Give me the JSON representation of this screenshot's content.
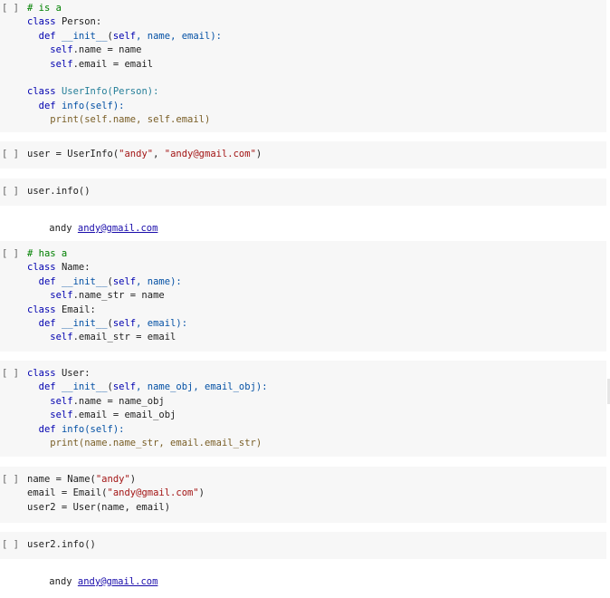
{
  "prompt_label": "[ ]",
  "cells": [
    {
      "lines": [
        [
          {
            "t": "# is a",
            "c": "c"
          }
        ],
        [
          {
            "t": "class ",
            "c": "k"
          },
          {
            "t": "Person:",
            "c": ""
          }
        ],
        [
          {
            "t": "  def ",
            "c": "k"
          },
          {
            "t": "__init__",
            "c": "d"
          },
          {
            "t": "(",
            "c": ""
          },
          {
            "t": "self",
            "c": "self"
          },
          {
            "t": ", name, email):",
            "c": "d"
          }
        ],
        [
          {
            "t": "    self",
            "c": "self"
          },
          {
            "t": ".name = name",
            "c": ""
          }
        ],
        [
          {
            "t": "    self",
            "c": "self"
          },
          {
            "t": ".email = email",
            "c": ""
          }
        ],
        [
          {
            "t": "",
            "c": ""
          }
        ],
        [
          {
            "t": "class ",
            "c": "k"
          },
          {
            "t": "UserInfo(Person):",
            "c": "cls"
          }
        ],
        [
          {
            "t": "  def ",
            "c": "k"
          },
          {
            "t": "info(self):",
            "c": "d"
          }
        ],
        [
          {
            "t": "    print",
            "c": "b"
          },
          {
            "t": "(self.name, self.email)",
            "c": "b"
          }
        ]
      ]
    },
    {
      "lines": [
        [
          {
            "t": "user = UserInfo(",
            "c": ""
          },
          {
            "t": "\"andy\"",
            "c": "s"
          },
          {
            "t": ", ",
            "c": ""
          },
          {
            "t": "\"andy@gmail.com\"",
            "c": "s"
          },
          {
            "t": ")",
            "c": ""
          }
        ]
      ]
    },
    {
      "lines": [
        [
          {
            "t": "user.info()",
            "c": ""
          }
        ]
      ],
      "output": {
        "text": "andy ",
        "link": "andy@gmail.com"
      }
    },
    {
      "lines": [
        [
          {
            "t": "# has a",
            "c": "c"
          }
        ],
        [
          {
            "t": "class ",
            "c": "k"
          },
          {
            "t": "Name:",
            "c": ""
          }
        ],
        [
          {
            "t": "  def ",
            "c": "k"
          },
          {
            "t": "__init__",
            "c": "d"
          },
          {
            "t": "(",
            "c": ""
          },
          {
            "t": "self",
            "c": "self"
          },
          {
            "t": ", name):",
            "c": "d"
          }
        ],
        [
          {
            "t": "    self",
            "c": "self"
          },
          {
            "t": ".name_str = name",
            "c": ""
          }
        ],
        [
          {
            "t": "class ",
            "c": "k"
          },
          {
            "t": "Email:",
            "c": ""
          }
        ],
        [
          {
            "t": "  def ",
            "c": "k"
          },
          {
            "t": "__init__",
            "c": "d"
          },
          {
            "t": "(",
            "c": ""
          },
          {
            "t": "self",
            "c": "self"
          },
          {
            "t": ", email):",
            "c": "d"
          }
        ],
        [
          {
            "t": "    self",
            "c": "self"
          },
          {
            "t": ".email_str = email",
            "c": ""
          }
        ]
      ]
    },
    {
      "lines": [
        [
          {
            "t": "class ",
            "c": "k"
          },
          {
            "t": "User:",
            "c": ""
          }
        ],
        [
          {
            "t": "  def ",
            "c": "k"
          },
          {
            "t": "__init__",
            "c": "d"
          },
          {
            "t": "(",
            "c": ""
          },
          {
            "t": "self",
            "c": "self"
          },
          {
            "t": ", name_obj, email_obj):",
            "c": "d"
          }
        ],
        [
          {
            "t": "    self",
            "c": "self"
          },
          {
            "t": ".name = name_obj",
            "c": ""
          }
        ],
        [
          {
            "t": "    self",
            "c": "self"
          },
          {
            "t": ".email = email_obj",
            "c": ""
          }
        ],
        [
          {
            "t": "  def ",
            "c": "k"
          },
          {
            "t": "info(self):",
            "c": "d"
          }
        ],
        [
          {
            "t": "    print",
            "c": "b"
          },
          {
            "t": "(name.name_str, email.email_str)",
            "c": "b"
          }
        ]
      ]
    },
    {
      "lines": [
        [
          {
            "t": "name = Name(",
            "c": ""
          },
          {
            "t": "\"andy\"",
            "c": "s"
          },
          {
            "t": ")",
            "c": ""
          }
        ],
        [
          {
            "t": "email = Email(",
            "c": ""
          },
          {
            "t": "\"andy@gmail.com\"",
            "c": "s"
          },
          {
            "t": ")",
            "c": ""
          }
        ],
        [
          {
            "t": "user2 = User(name, email)",
            "c": ""
          }
        ]
      ]
    },
    {
      "lines": [
        [
          {
            "t": "user2.info()",
            "c": ""
          }
        ]
      ],
      "output": {
        "text": "andy ",
        "link": "andy@gmail.com"
      }
    }
  ]
}
